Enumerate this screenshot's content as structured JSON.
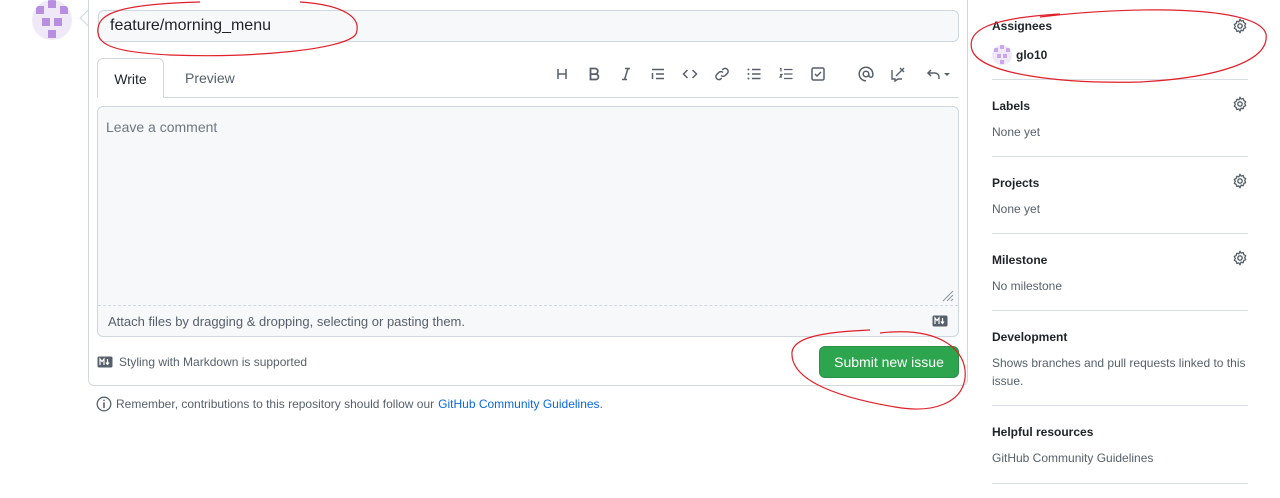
{
  "issue": {
    "title_value": "feature/morning_menu",
    "tabs": [
      {
        "label": "Write"
      },
      {
        "label": "Preview"
      }
    ],
    "toolbar_icons": [
      "heading-icon",
      "bold-icon",
      "italic-icon",
      "quote-icon",
      "code-icon",
      "link-icon",
      "unordered-list-icon",
      "ordered-list-icon",
      "task-list-icon",
      "mention-icon",
      "reference-icon",
      "undo-icon"
    ],
    "comment_placeholder": "Leave a comment",
    "attach_text": "Attach files by dragging & dropping, selecting or pasting them.",
    "markdown_support": "Styling with Markdown is supported",
    "submit_label": "Submit new issue",
    "guidelines_prefix": "Remember, contributions to this repository should follow our",
    "guidelines_link": "GitHub Community Guidelines",
    "guidelines_suffix": "."
  },
  "sidebar": {
    "assignees": {
      "heading": "Assignees",
      "user": "glo10"
    },
    "labels": {
      "heading": "Labels",
      "value": "None yet"
    },
    "projects": {
      "heading": "Projects",
      "value": "None yet"
    },
    "milestone": {
      "heading": "Milestone",
      "value": "No milestone"
    },
    "development": {
      "heading": "Development",
      "value": "Shows branches and pull requests linked to this issue."
    },
    "helpful": {
      "heading": "Helpful resources",
      "link": "GitHub Community Guidelines"
    }
  },
  "colors": {
    "primary_button": "#2da44e",
    "link": "#0969da",
    "annotation": "#e0202a",
    "avatar": "#b88ee0"
  }
}
